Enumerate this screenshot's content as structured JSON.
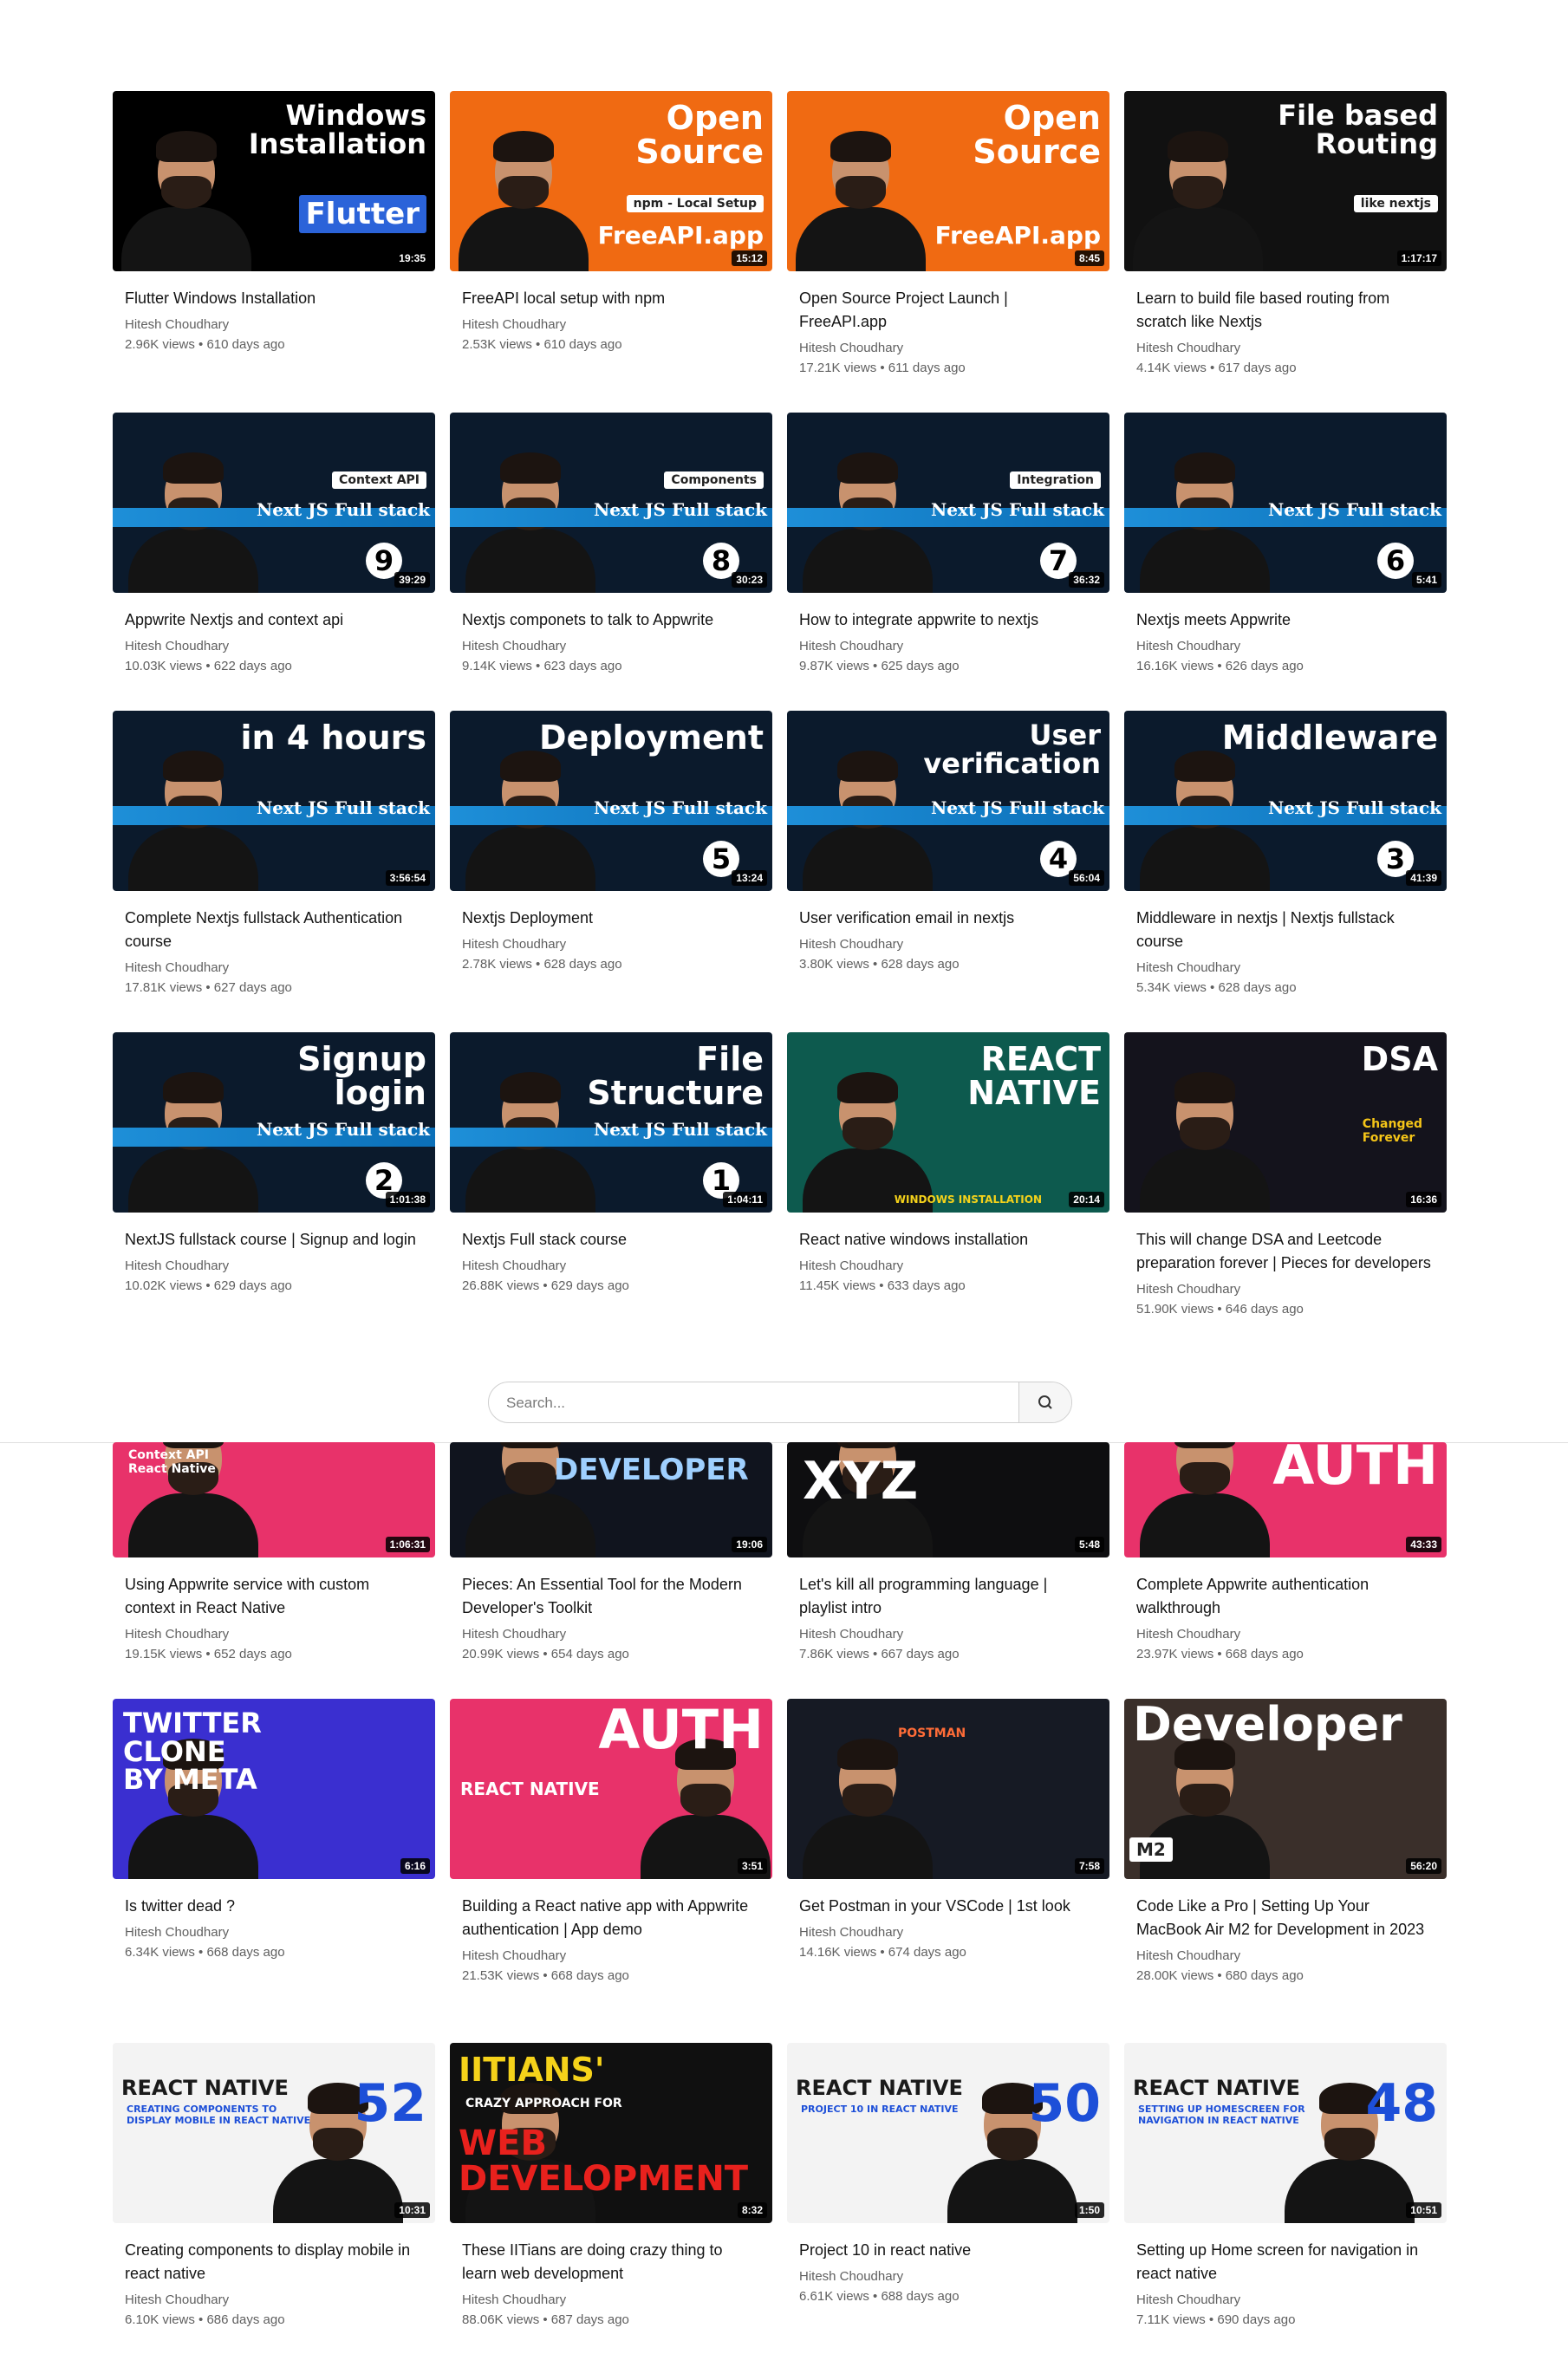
{
  "search": {
    "placeholder": "Search..."
  },
  "videos": [
    {
      "title": "Flutter Windows Installation",
      "author": "Hitesh Choudhary",
      "meta": "2.96K views • 610 days ago",
      "duration": "19:35",
      "thumb_text": "Windows\nInstallation",
      "thumb_text2": "Flutter",
      "bg": "#000000",
      "accent": "#2b63d9"
    },
    {
      "title": "FreeAPI local setup with npm",
      "author": "Hitesh Choudhary",
      "meta": "2.53K views • 610 days ago",
      "duration": "15:12",
      "thumb_text": "Open\nSource",
      "thumb_text2": "npm - Local Setup",
      "thumb_text3": "FreeAPI.app",
      "bg": "#f06a12",
      "accent": "#111111"
    },
    {
      "title": "Open Source Project Launch | FreeAPI.app",
      "author": "Hitesh Choudhary",
      "meta": "17.21K views • 611 days ago",
      "duration": "8:45",
      "thumb_text": "Open\nSource",
      "thumb_text3": "FreeAPI.app",
      "bg": "#f06a12",
      "accent": "#111111"
    },
    {
      "title": "Learn to build file based routing from scratch like Nextjs",
      "author": "Hitesh Choudhary",
      "meta": "4.14K views • 617 days ago",
      "duration": "1:17:17",
      "thumb_text": "File based\nRouting",
      "thumb_text2": "like nextjs",
      "bg": "#111111",
      "accent": "#f5c518"
    },
    {
      "title": "Appwrite Nextjs and context api",
      "author": "Hitesh Choudhary",
      "meta": "10.03K views • 622 days ago",
      "duration": "39:29",
      "thumb_text2": "Context API",
      "number": "9",
      "bg": "#0b1a2c",
      "accent": "#1e8fd8"
    },
    {
      "title": "Nextjs componets to talk to Appwrite",
      "author": "Hitesh Choudhary",
      "meta": "9.14K views • 623 days ago",
      "duration": "30:23",
      "thumb_text2": "Components",
      "number": "8",
      "bg": "#0b1a2c",
      "accent": "#1e8fd8"
    },
    {
      "title": "How to integrate appwrite to nextjs",
      "author": "Hitesh Choudhary",
      "meta": "9.87K views • 625 days ago",
      "duration": "36:32",
      "thumb_text2": "Integration",
      "number": "7",
      "bg": "#0b1a2c",
      "accent": "#1e8fd8"
    },
    {
      "title": "Nextjs meets Appwrite",
      "author": "Hitesh Choudhary",
      "meta": "16.16K views • 626 days ago",
      "duration": "5:41",
      "number": "6",
      "bg": "#0b1a2c",
      "accent": "#1e8fd8"
    },
    {
      "title": "Complete Nextjs fullstack Authentication course",
      "author": "Hitesh Choudhary",
      "meta": "17.81K views • 627 days ago",
      "duration": "3:56:54",
      "thumb_text": "in 4 hours",
      "bg": "#0b1a2c",
      "accent": "#1e8fd8"
    },
    {
      "title": "Nextjs Deployment",
      "author": "Hitesh Choudhary",
      "meta": "2.78K views • 628 days ago",
      "duration": "13:24",
      "thumb_text": "Deployment",
      "number": "5",
      "bg": "#0b1a2c",
      "accent": "#1e8fd8"
    },
    {
      "title": "User verification email in nextjs",
      "author": "Hitesh Choudhary",
      "meta": "3.80K views • 628 days ago",
      "duration": "56:04",
      "thumb_text": "User\nverification",
      "number": "4",
      "bg": "#0b1a2c",
      "accent": "#1e8fd8"
    },
    {
      "title": "Middleware in nextjs | Nextjs fullstack course",
      "author": "Hitesh Choudhary",
      "meta": "5.34K views • 628 days ago",
      "duration": "41:39",
      "thumb_text": "Middleware",
      "number": "3",
      "bg": "#0b1a2c",
      "accent": "#1e8fd8"
    },
    {
      "title": "NextJS fullstack course | Signup and login",
      "author": "Hitesh Choudhary",
      "meta": "10.02K views • 629 days ago",
      "duration": "1:01:38",
      "thumb_text": "Signup\nlogin",
      "number": "2",
      "bg": "#0b1a2c",
      "accent": "#1e8fd8"
    },
    {
      "title": "Nextjs Full stack course",
      "author": "Hitesh Choudhary",
      "meta": "26.88K views • 629 days ago",
      "duration": "1:04:11",
      "thumb_text": "File\nStructure",
      "number": "1",
      "bg": "#0b1a2c",
      "accent": "#1e8fd8"
    },
    {
      "title": "React native windows installation",
      "author": "Hitesh Choudhary",
      "meta": "11.45K views • 633 days ago",
      "duration": "20:14",
      "thumb_text": "REACT\nNATIVE",
      "thumb_text2": "WINDOWS INSTALLATION",
      "bg": "#0d5a4e",
      "accent": "#2ed6c8"
    },
    {
      "title": "This will change DSA and Leetcode preparation forever | Pieces for developers",
      "author": "Hitesh Choudhary",
      "meta": "51.90K views • 646 days ago",
      "duration": "16:36",
      "thumb_text": "DSA",
      "thumb_text2": "Changed\nForever",
      "bg": "#14131c",
      "accent": "#5a2a86"
    },
    {
      "title": "Using Appwrite service with custom context in React Native",
      "author": "Hitesh Choudhary",
      "meta": "19.15K views • 652 days ago",
      "duration": "1:06:31",
      "thumb_text2": "Context API\nReact Native",
      "bg": "#e8326a",
      "accent": "#e8326a"
    },
    {
      "title": "Pieces: An Essential Tool for the Modern Developer's Toolkit",
      "author": "Hitesh Choudhary",
      "meta": "20.99K views • 654 days ago",
      "duration": "19:06",
      "thumb_text": "DEVELOPER",
      "bg": "#10141e",
      "accent": "#1d5be0"
    },
    {
      "title": "Let's kill all programming language | playlist intro",
      "author": "Hitesh Choudhary",
      "meta": "7.86K views • 667 days ago",
      "duration": "5:48",
      "thumb_text": "XYZ",
      "bg": "#0e0e10",
      "accent": "#333333"
    },
    {
      "title": "Complete Appwrite authentication walkthrough",
      "author": "Hitesh Choudhary",
      "meta": "23.97K views • 668 days ago",
      "duration": "43:33",
      "thumb_text": "AUTH",
      "bg": "#e8326a",
      "accent": "#e8326a"
    },
    {
      "title": "Is twitter dead ?",
      "author": "Hitesh Choudhary",
      "meta": "6.34K views • 668 days ago",
      "duration": "6:16",
      "thumb_text": "TWITTER\nCLONE\nBY META",
      "bg": "#3a2fd0",
      "accent": "#3a2fd0"
    },
    {
      "title": "Building a React native app with Appwrite authentication | App demo",
      "author": "Hitesh Choudhary",
      "meta": "21.53K views • 668 days ago",
      "duration": "3:51",
      "thumb_text": "AUTH",
      "thumb_text2": "REACT NATIVE",
      "bg": "#e8326a",
      "accent": "#e8326a"
    },
    {
      "title": "Get Postman in your VSCode | 1st look",
      "author": "Hitesh Choudhary",
      "meta": "14.16K views • 674 days ago",
      "duration": "7:58",
      "thumb_text2": "POSTMAN",
      "bg": "#161a24",
      "accent": "#ff6c37"
    },
    {
      "title": "Code Like a Pro | Setting Up Your MacBook Air M2 for Development in 2023",
      "author": "Hitesh Choudhary",
      "meta": "28.00K views • 680 days ago",
      "duration": "56:20",
      "thumb_text": "Developer",
      "thumb_text2": "M2",
      "bg": "#3a2f2a",
      "accent": "#222222"
    },
    {
      "title": "Creating components to display mobile in react native",
      "author": "Hitesh Choudhary",
      "meta": "6.10K views • 686 days ago",
      "duration": "10:31",
      "thumb_text": "REACT NATIVE",
      "thumb_text2": "CREATING COMPONENTS TO\nDISPLAY MOBILE IN REACT NATIVE",
      "number_big": "52",
      "bg": "#f3f3f3",
      "accent": "#1d4fd8"
    },
    {
      "title": "These IITians are doing crazy thing to learn web development",
      "author": "Hitesh Choudhary",
      "meta": "88.06K views • 687 days ago",
      "duration": "8:32",
      "thumb_text": "IITIANS'",
      "thumb_text2": "CRAZY APPROACH FOR",
      "thumb_text3": "WEB\nDEVELOPMENT",
      "bg": "#101010",
      "accent": "#f5d21a"
    },
    {
      "title": "Project 10 in react native",
      "author": "Hitesh Choudhary",
      "meta": "6.61K views • 688 days ago",
      "duration": "1:50",
      "thumb_text": "REACT NATIVE",
      "thumb_text2": "PROJECT 10 IN REACT NATIVE",
      "number_big": "50",
      "bg": "#f3f3f3",
      "accent": "#1d4fd8"
    },
    {
      "title": "Setting up Home screen for navigation in react native",
      "author": "Hitesh Choudhary",
      "meta": "7.11K views • 690 days ago",
      "duration": "10:51",
      "thumb_text": "REACT NATIVE",
      "thumb_text2": "SETTING UP HOMESCREEN FOR\nNAVIGATION IN REACT NATIVE",
      "number_big": "48",
      "bg": "#f3f3f3",
      "accent": "#1d4fd8"
    }
  ]
}
